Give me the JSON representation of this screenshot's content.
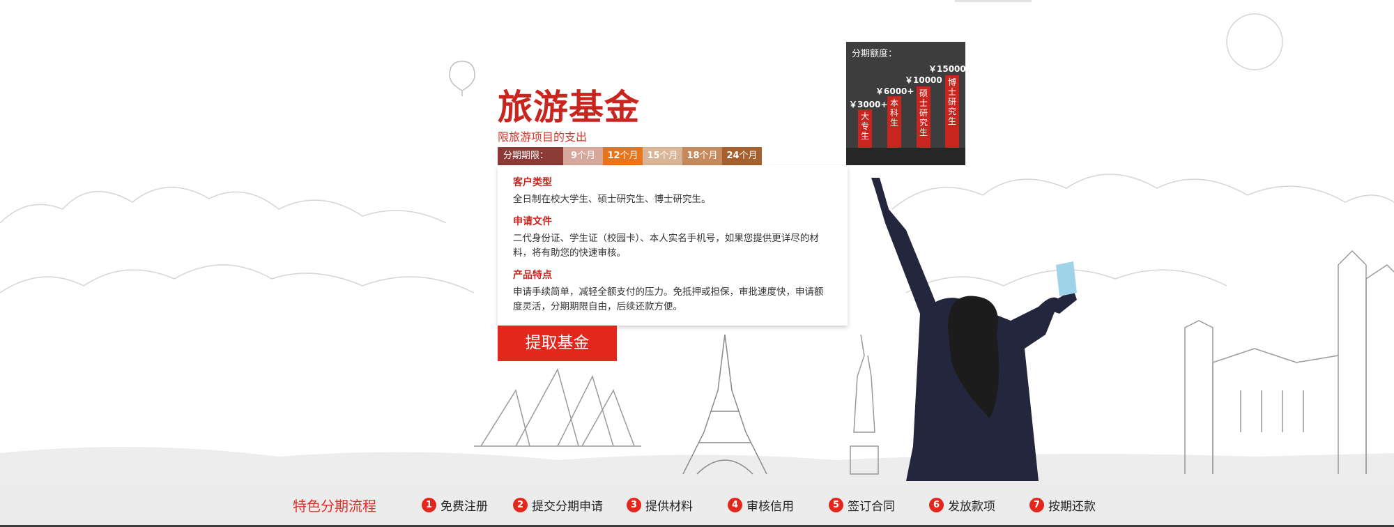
{
  "product": {
    "title": "旅游基金",
    "subtitle": "限旅游项目的支出"
  },
  "terms": {
    "label": "分期期限：",
    "items": [
      {
        "num": "9",
        "unit": "个月",
        "color": "#d6a89b"
      },
      {
        "num": "12",
        "unit": "个月",
        "color": "#e8741c"
      },
      {
        "num": "15",
        "unit": "个月",
        "color": "#d9b496"
      },
      {
        "num": "18",
        "unit": "个月",
        "color": "#c48a5c"
      },
      {
        "num": "24",
        "unit": "个月",
        "color": "#a65f2e"
      }
    ]
  },
  "info": {
    "customer_heading": "客户类型",
    "customer_text": "全日制在校大学生、硕士研究生、博士研究生。",
    "docs_heading": "申请文件",
    "docs_text": "二代身份证、学生证（校园卡）、本人实名手机号，如果您提供更详尽的材料，将有助您的快速审核。",
    "features_heading": "产品特点",
    "features_text": "申请手续简单，减轻全额支付的压力。免抵押或担保，审批速度快，申请额度灵活，分期期限自由，后续还款方便。"
  },
  "cta_label": "提取基金",
  "quota": {
    "title": "分期额度：",
    "levels": [
      {
        "amount": "￥3000+",
        "label": "大专生"
      },
      {
        "amount": "￥6000+",
        "label": "本科生"
      },
      {
        "amount": "￥10000",
        "label": "硕士研究生"
      },
      {
        "amount": "￥15000",
        "label": "博士研究生"
      }
    ]
  },
  "process": {
    "title": "特色分期流程",
    "steps": [
      {
        "num": "1",
        "label": "免费注册"
      },
      {
        "num": "2",
        "label": "提交分期申请"
      },
      {
        "num": "3",
        "label": "提供材料"
      },
      {
        "num": "4",
        "label": "审核信用"
      },
      {
        "num": "5",
        "label": "签订合同"
      },
      {
        "num": "6",
        "label": "发放款项"
      },
      {
        "num": "7",
        "label": "按期还款"
      }
    ]
  },
  "colors": {
    "brand_red": "#e2281c",
    "title_red": "#c8251f"
  }
}
